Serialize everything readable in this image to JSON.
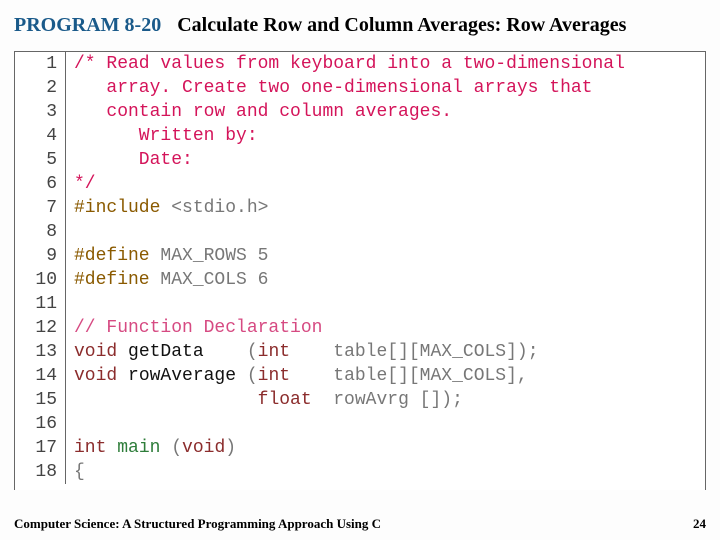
{
  "header": {
    "program_label": "PROGRAM 8-20",
    "title": "Calculate Row and Column Averages: Row Averages"
  },
  "code": {
    "lines": [
      {
        "n": "1",
        "segments": [
          {
            "cls": "c-red",
            "t": "/* Read values from keyboard into a two-dimensional"
          }
        ]
      },
      {
        "n": "2",
        "segments": [
          {
            "cls": "c-red",
            "t": "   array. Create two one-dimensional arrays that"
          }
        ]
      },
      {
        "n": "3",
        "segments": [
          {
            "cls": "c-red",
            "t": "   contain row and column averages."
          }
        ]
      },
      {
        "n": "4",
        "segments": [
          {
            "cls": "c-red",
            "t": "      Written by:"
          }
        ]
      },
      {
        "n": "5",
        "segments": [
          {
            "cls": "c-red",
            "t": "      Date:"
          }
        ]
      },
      {
        "n": "6",
        "segments": [
          {
            "cls": "c-red",
            "t": "*/"
          }
        ]
      },
      {
        "n": "7",
        "segments": [
          {
            "cls": "c-brown",
            "t": "#include "
          },
          {
            "cls": "c-gray",
            "t": "<stdio.h>"
          }
        ]
      },
      {
        "n": "8",
        "segments": []
      },
      {
        "n": "9",
        "segments": [
          {
            "cls": "c-brown",
            "t": "#define "
          },
          {
            "cls": "c-gray",
            "t": "MAX_ROWS 5"
          }
        ]
      },
      {
        "n": "10",
        "segments": [
          {
            "cls": "c-brown",
            "t": "#define "
          },
          {
            "cls": "c-gray",
            "t": "MAX_COLS 6"
          }
        ]
      },
      {
        "n": "11",
        "segments": []
      },
      {
        "n": "12",
        "segments": [
          {
            "cls": "c-pink",
            "t": "// Function Declaration"
          }
        ]
      },
      {
        "n": "13",
        "segments": [
          {
            "cls": "c-darkred",
            "t": "void "
          },
          {
            "cls": "c-black",
            "t": "getData    "
          },
          {
            "cls": "c-gray",
            "t": "("
          },
          {
            "cls": "c-darkred",
            "t": "int"
          },
          {
            "cls": "c-gray",
            "t": "    table[][MAX_COLS]);"
          }
        ]
      },
      {
        "n": "14",
        "segments": [
          {
            "cls": "c-darkred",
            "t": "void "
          },
          {
            "cls": "c-black",
            "t": "rowAverage "
          },
          {
            "cls": "c-gray",
            "t": "("
          },
          {
            "cls": "c-darkred",
            "t": "int"
          },
          {
            "cls": "c-gray",
            "t": "    table[][MAX_COLS],"
          }
        ]
      },
      {
        "n": "15",
        "segments": [
          {
            "cls": "c-gray",
            "t": "                 "
          },
          {
            "cls": "c-darkred",
            "t": "float"
          },
          {
            "cls": "c-gray",
            "t": "  rowAvrg []);"
          }
        ]
      },
      {
        "n": "16",
        "segments": []
      },
      {
        "n": "17",
        "segments": [
          {
            "cls": "c-darkred",
            "t": "int "
          },
          {
            "cls": "c-green",
            "t": "main "
          },
          {
            "cls": "c-gray",
            "t": "("
          },
          {
            "cls": "c-darkred",
            "t": "void"
          },
          {
            "cls": "c-gray",
            "t": ")"
          }
        ]
      },
      {
        "n": "18",
        "segments": [
          {
            "cls": "c-gray",
            "t": "{"
          }
        ]
      }
    ]
  },
  "footer": {
    "left": "Computer Science: A Structured Programming Approach Using C",
    "right": "24"
  }
}
